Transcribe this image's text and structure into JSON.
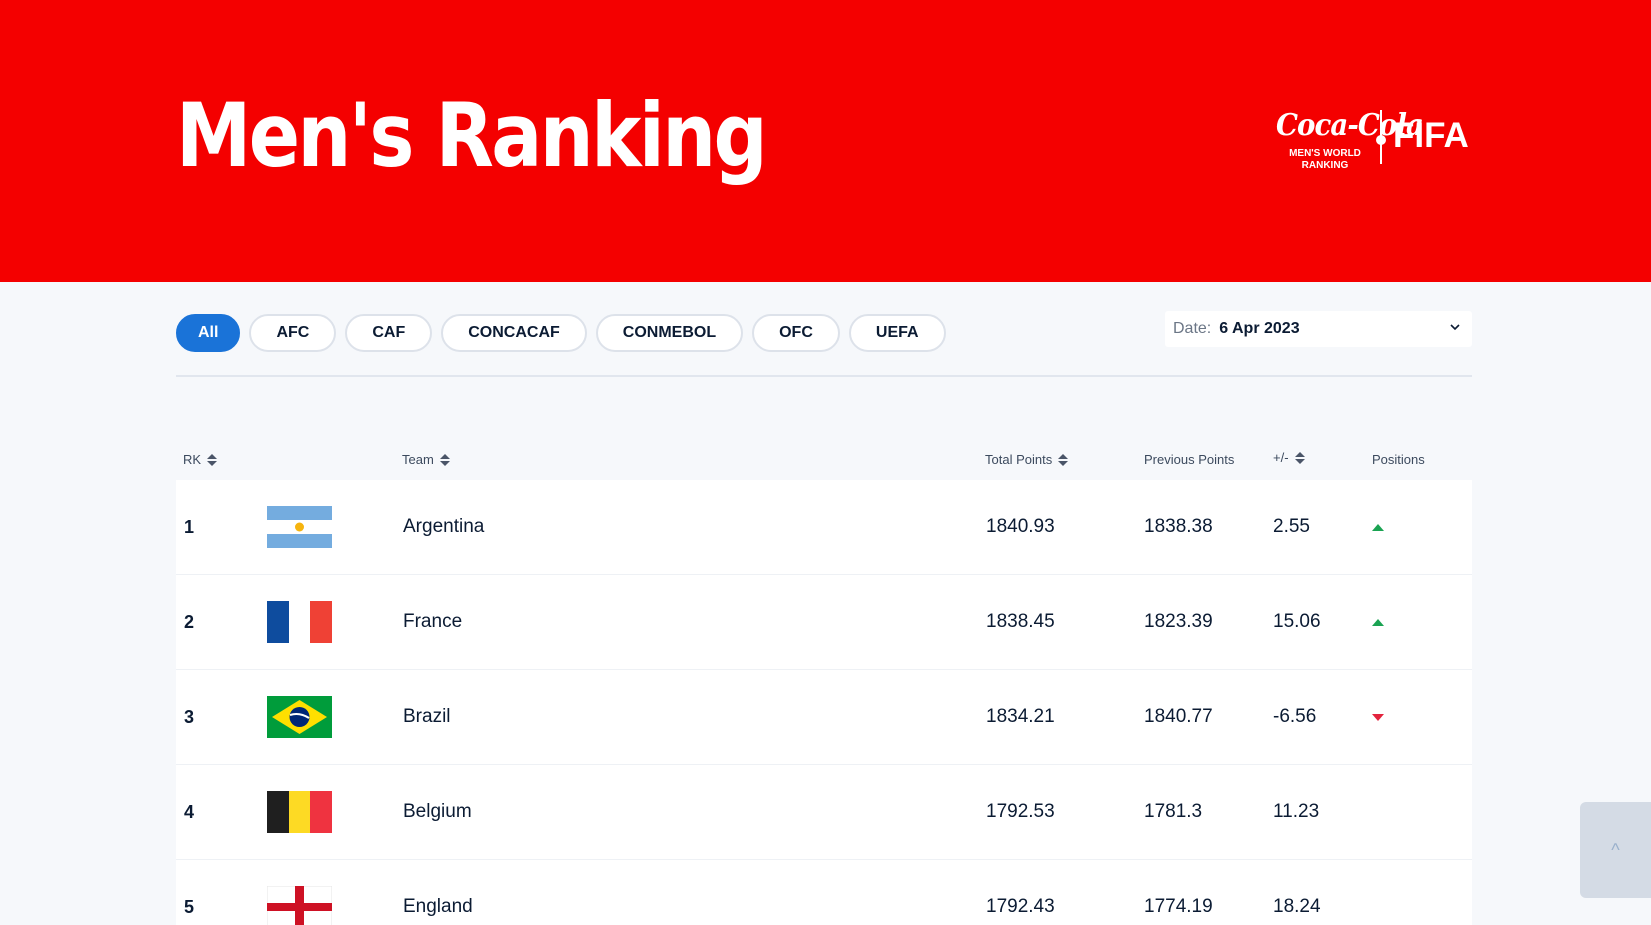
{
  "header": {
    "title": "Men's Ranking",
    "logo": {
      "brand_script": "Coca-Cola",
      "sub_line1": "MEN'S WORLD",
      "sub_line2": "RANKING",
      "fifa": "FIFA"
    },
    "background_color": "#f40000"
  },
  "filters": {
    "items": [
      {
        "label": "All",
        "active": true
      },
      {
        "label": "AFC",
        "active": false
      },
      {
        "label": "CAF",
        "active": false
      },
      {
        "label": "CONCACAF",
        "active": false
      },
      {
        "label": "CONMEBOL",
        "active": false
      },
      {
        "label": "OFC",
        "active": false
      },
      {
        "label": "UEFA",
        "active": false
      }
    ],
    "active_color": "#1a73d8"
  },
  "date": {
    "label": "Date:",
    "value": "6 Apr 2023",
    "icon": "chevron-down-icon"
  },
  "table": {
    "columns": {
      "rk": "RK",
      "team": "Team",
      "total": "Total Points",
      "prev": "Previous Points",
      "diff": "+/-",
      "positions": "Positions"
    },
    "rows": [
      {
        "rank": "1",
        "team": "Argentina",
        "flag": "argentina-flag-icon",
        "total": "1840.93",
        "prev": "1838.38",
        "diff": "2.55",
        "trend": "up"
      },
      {
        "rank": "2",
        "team": "France",
        "flag": "france-flag-icon",
        "total": "1838.45",
        "prev": "1823.39",
        "diff": "15.06",
        "trend": "up"
      },
      {
        "rank": "3",
        "team": "Brazil",
        "flag": "brazil-flag-icon",
        "total": "1834.21",
        "prev": "1840.77",
        "diff": "-6.56",
        "trend": "down"
      },
      {
        "rank": "4",
        "team": "Belgium",
        "flag": "belgium-flag-icon",
        "total": "1792.53",
        "prev": "1781.3",
        "diff": "11.23",
        "trend": "none"
      },
      {
        "rank": "5",
        "team": "England",
        "flag": "england-flag-icon",
        "total": "1792.43",
        "prev": "1774.19",
        "diff": "18.24",
        "trend": "none"
      }
    ],
    "trend_colors": {
      "up": "#1aa352",
      "down": "#e3233d"
    }
  },
  "scroll_top": {
    "glyph": "^",
    "icon": "caret-up-icon"
  }
}
